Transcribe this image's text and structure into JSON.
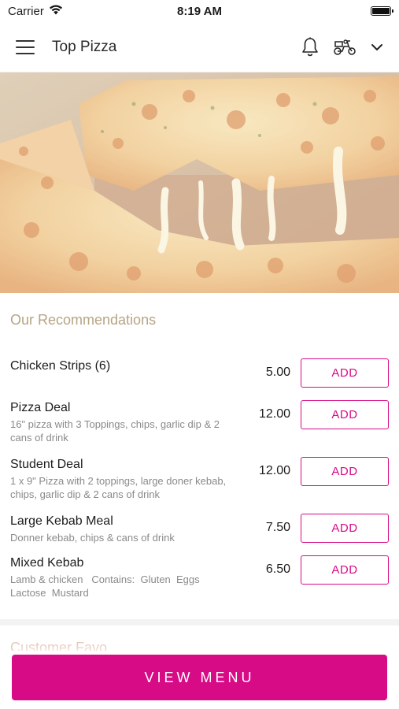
{
  "status_bar": {
    "carrier": "Carrier",
    "time": "8:19 AM",
    "icons": [
      "wifi-icon",
      "battery-icon"
    ]
  },
  "header": {
    "title": "Top Pizza",
    "icons": [
      "hamburger-menu-icon",
      "bell-icon",
      "delivery-scooter-icon",
      "chevron-down-icon"
    ]
  },
  "hero": {
    "image": "pizza-cheese-pull-photo"
  },
  "recommendations": {
    "title": "Our Recommendations",
    "items": [
      {
        "name": "Chicken Strips (6)",
        "description": "",
        "price": "5.00",
        "button": "ADD"
      },
      {
        "name": "Pizza Deal",
        "description": "16\" pizza with 3 Toppings, chips, garlic dip & 2 cans of drink",
        "price": "12.00",
        "button": "ADD"
      },
      {
        "name": "Student Deal",
        "description": "1 x 9\" Pizza with 2 toppings, large doner kebab, chips, garlic dip & 2 cans of drink",
        "price": "12.00",
        "button": "ADD"
      },
      {
        "name": "Large Kebab Meal",
        "description": "Donner kebab, chips & cans of drink",
        "price": "7.50",
        "button": "ADD"
      },
      {
        "name": "Mixed Kebab",
        "description": "Lamb & chicken   Contains:  Gluten  Eggs  Lactose  Mustard",
        "price": "6.50",
        "button": "ADD"
      }
    ]
  },
  "next_section_peek": "Customer Favo",
  "footer": {
    "view_menu": "VIEW MENU"
  },
  "colors": {
    "accent": "#d80b87",
    "section_title": "#b7a584",
    "text": "#1c1c1c",
    "muted": "#8a8a8a"
  }
}
